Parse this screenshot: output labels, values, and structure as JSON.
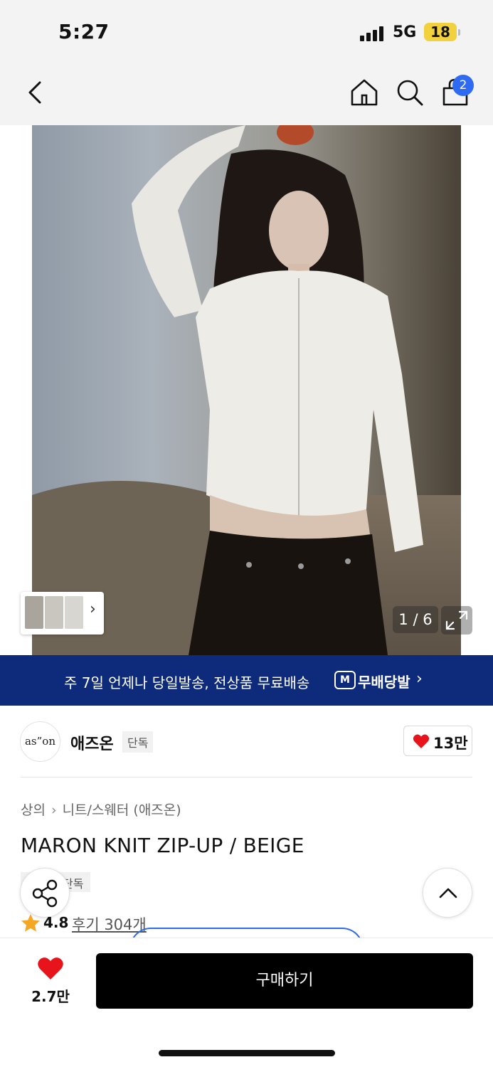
{
  "status_bar": {
    "time": "5:27",
    "network": "5G",
    "battery": "18"
  },
  "header": {
    "back_icon": "chevron-left-icon",
    "home_icon": "home-icon",
    "search_icon": "search-icon",
    "cart_icon": "shopping-bag-icon",
    "cart_count": "2"
  },
  "gallery": {
    "counter": "1 / 6",
    "expand_icon": "expand-icon",
    "thumb_arrow": "›"
  },
  "banner": {
    "text": "주 7일 언제나 당일발송, 전상품 무료배송",
    "logo": "M",
    "brand": "무배당발",
    "chevron": "›"
  },
  "brand": {
    "logo_text": "as”on",
    "name": "애즈온",
    "tag": "단독",
    "likes": "13만"
  },
  "product": {
    "breadcrumb": [
      "상의",
      "니트/스웨터 (애즈온)"
    ],
    "breadcrumb_sep": "›",
    "title": "MARON KNIT ZIP-UP / BEIGE",
    "tag": "단독",
    "rating": "4.8",
    "reviews": "후기 304개"
  },
  "bottom_bar": {
    "wish_count": "2.7만",
    "buy_label": "구매하기"
  },
  "colors": {
    "accent_blue": "#2f6bf2",
    "banner_navy": "#0e2a7a",
    "heart_red": "#e8141b",
    "star_orange": "#f5a623"
  }
}
